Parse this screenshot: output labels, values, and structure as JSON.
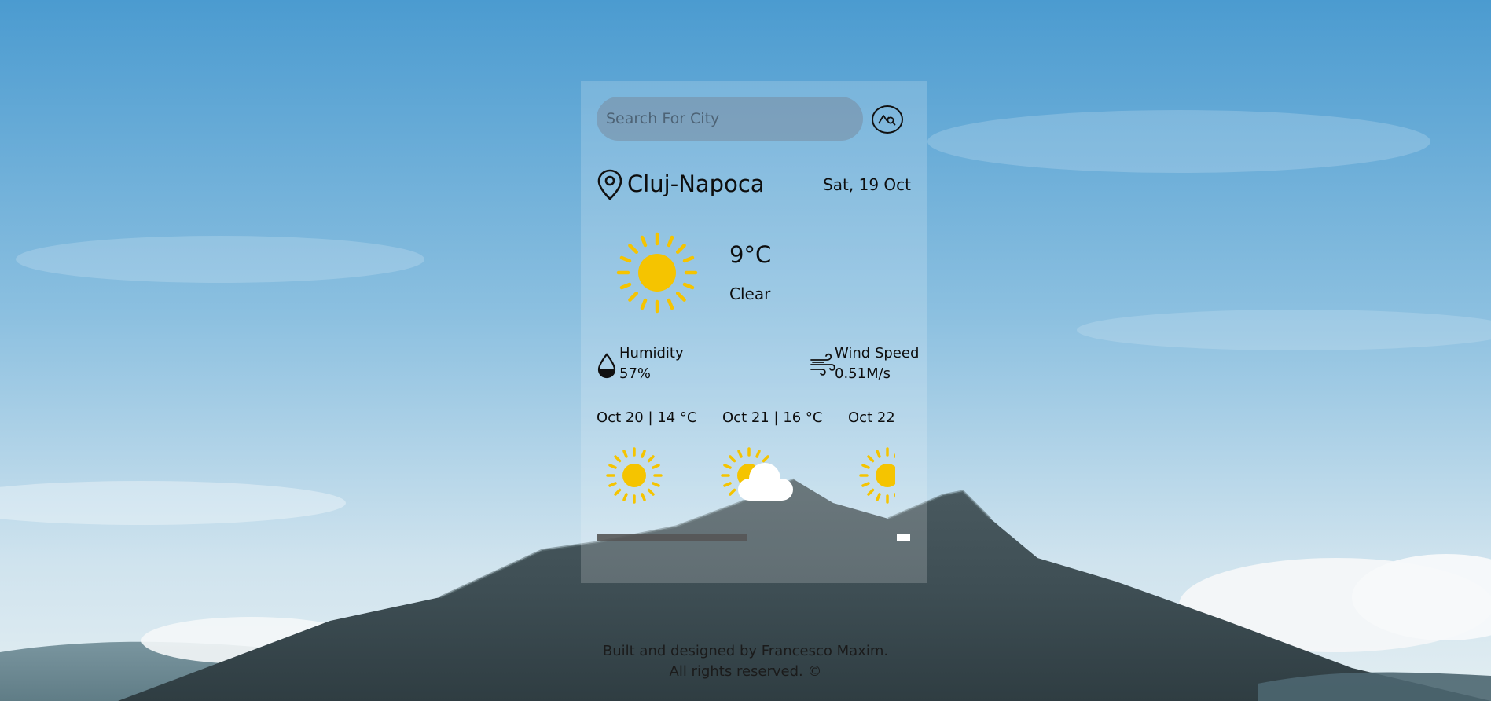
{
  "search": {
    "placeholder": "Search For City",
    "button_icon": "mountain-search-icon"
  },
  "location": {
    "icon": "location-pin-icon",
    "city": "Cluj-Napoca",
    "date": "Sat, 19 Oct"
  },
  "current": {
    "icon": "sun-icon",
    "temperature": "9°C",
    "condition": "Clear"
  },
  "details": {
    "humidity": {
      "icon": "humidity-drop-icon",
      "label": "Humidity",
      "value": "57%"
    },
    "wind": {
      "icon": "wind-icon",
      "label": "Wind Speed",
      "value": "0.51M/s"
    }
  },
  "forecast": [
    {
      "label": "Oct 20 | 14 °C",
      "icon": "sun-icon"
    },
    {
      "label": "Oct 21 | 16 °C",
      "icon": "sun-cloud-icon"
    },
    {
      "label": "Oct 22 |",
      "icon": "sun-icon"
    }
  ],
  "colors": {
    "sun": "#f5c400",
    "sky_top": "#4f9fd2",
    "sky_bottom": "#d4e7ef",
    "mountain": "#3a4a50"
  },
  "footer": {
    "line1": "Built and designed by Francesco Maxim.",
    "line2": "All rights reserved. ©"
  }
}
